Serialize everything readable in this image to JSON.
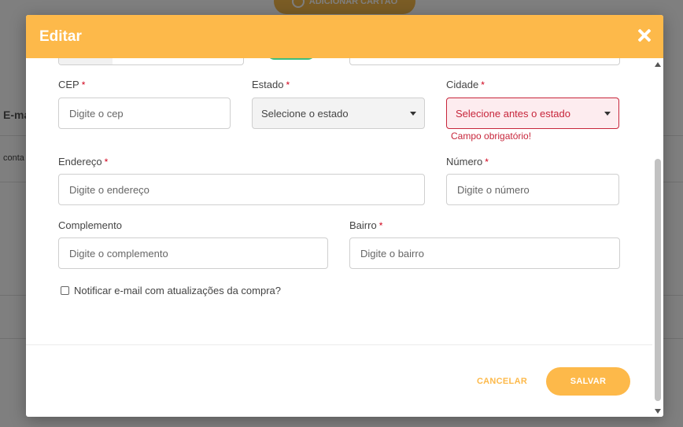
{
  "background": {
    "add_card_label": "ADICIONAR CARTÃO",
    "column_header": "E-ma",
    "row_cell": "conta"
  },
  "modal": {
    "title": "Editar",
    "fields": {
      "cep": {
        "label": "CEP",
        "required_mark": "*",
        "placeholder": "Digite o cep"
      },
      "estado": {
        "label": "Estado",
        "required_mark": "*",
        "value": "Selecione o estado"
      },
      "cidade": {
        "label": "Cidade",
        "required_mark": "*",
        "value": "Selecione antes o estado",
        "error": "Campo obrigatório!"
      },
      "endereco": {
        "label": "Endereço",
        "required_mark": "*",
        "placeholder": "Digite o endereço"
      },
      "numero": {
        "label": "Número",
        "required_mark": "*",
        "placeholder": "Digite o número"
      },
      "complemento": {
        "label": "Complemento",
        "placeholder": "Digite o complemento"
      },
      "bairro": {
        "label": "Bairro",
        "required_mark": "*",
        "placeholder": "Digite o bairro"
      }
    },
    "notify_label": "Notificar e-mail com atualizações da compra?",
    "notify_checked": false,
    "cancel_label": "CANCELAR",
    "save_label": "SALVAR"
  },
  "colors": {
    "accent": "#fdb94a",
    "error": "#c7263b",
    "toggle_on": "#3dbd7d"
  }
}
